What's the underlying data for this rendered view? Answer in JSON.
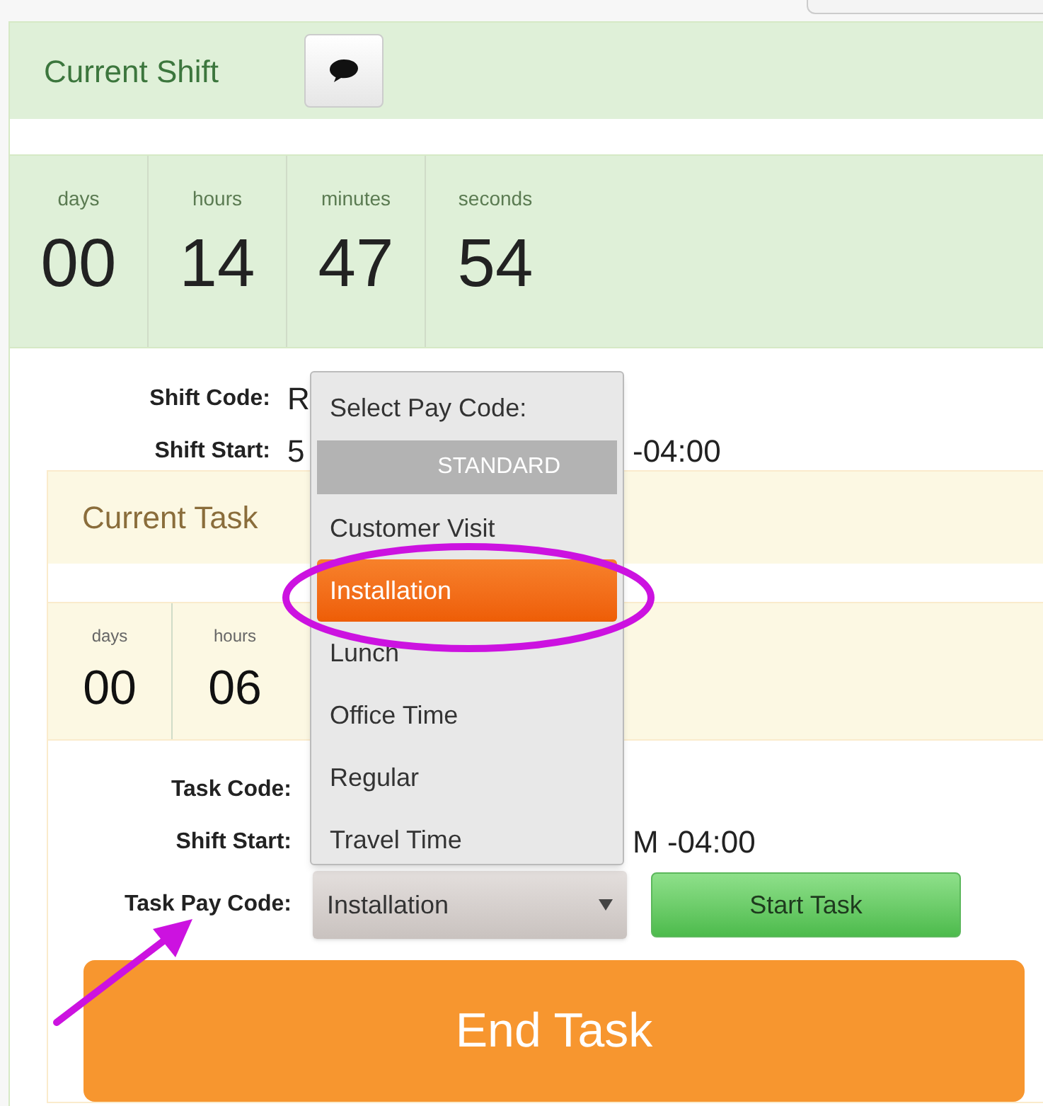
{
  "shift": {
    "title": "Current Shift",
    "timer": [
      {
        "label": "days",
        "value": "00"
      },
      {
        "label": "hours",
        "value": "14"
      },
      {
        "label": "minutes",
        "value": "47"
      },
      {
        "label": "seconds",
        "value": "54"
      }
    ],
    "fields": [
      {
        "label": "Shift Code:",
        "value": "R"
      },
      {
        "label": "Shift Start:",
        "value": "5",
        "value_end": "-04:00"
      }
    ]
  },
  "task": {
    "title": "Current Task",
    "timer": [
      {
        "label": "days",
        "value": "00"
      },
      {
        "label": "hours",
        "value": "06"
      }
    ],
    "fields": [
      {
        "label": "Task Code:"
      },
      {
        "label": "Shift Start:",
        "value_end": "M -04:00"
      }
    ],
    "pay_code": {
      "label": "Task Pay Code:",
      "value": "Installation"
    },
    "start_button": "Start Task",
    "end_button": "End Task"
  },
  "pay_code_menu": {
    "title": "Select Pay Code:",
    "groups": [
      {
        "label": "STANDARD",
        "options": [
          {
            "label": "Customer Visit",
            "selected": false
          },
          {
            "label": "Installation",
            "selected": true
          },
          {
            "label": "Lunch",
            "selected": false
          },
          {
            "label": "Office Time",
            "selected": false
          },
          {
            "label": "Regular",
            "selected": false
          },
          {
            "label": "Travel Time",
            "selected": false
          }
        ]
      }
    ]
  }
}
